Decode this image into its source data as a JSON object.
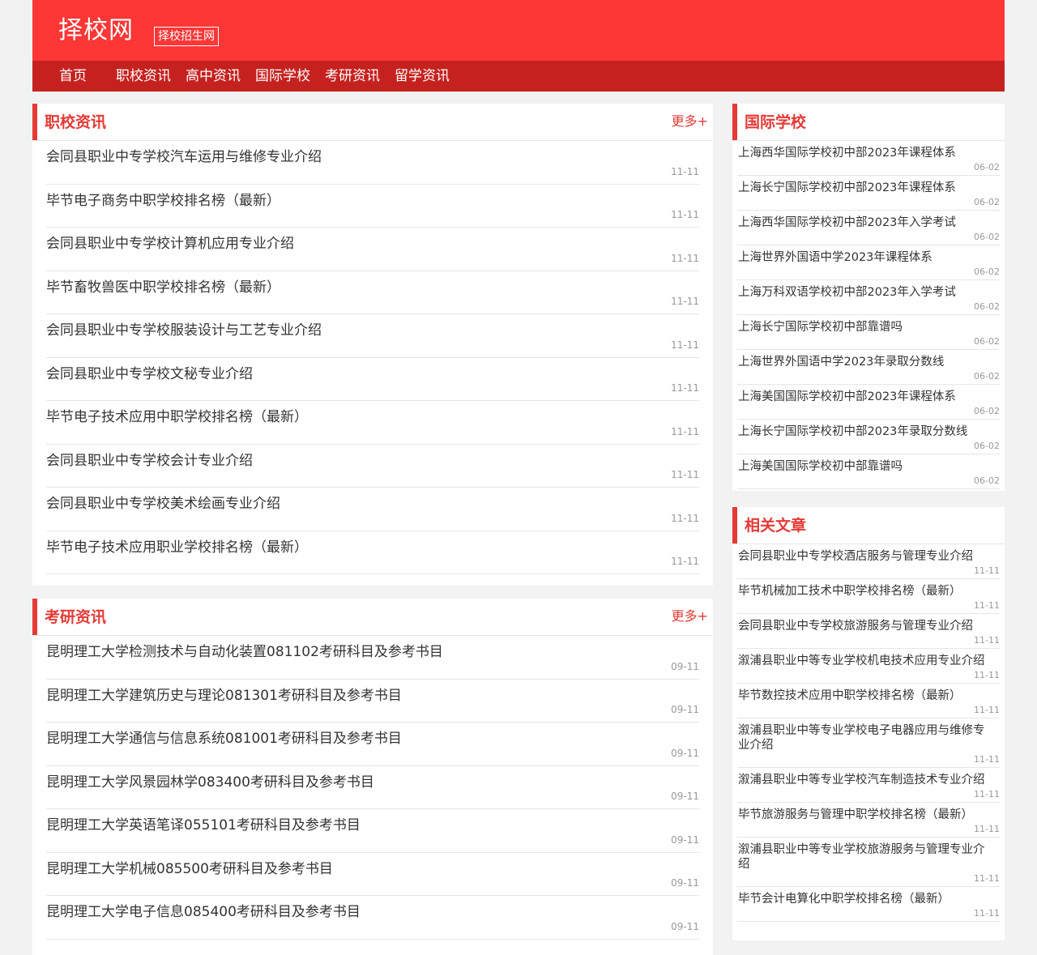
{
  "header": {
    "logo": "择校网",
    "tagline": "择校招生网"
  },
  "nav": {
    "items": [
      "首页",
      "职校资讯",
      "高中资讯",
      "国际学校",
      "考研资讯",
      "留学资讯"
    ]
  },
  "left_panels": [
    {
      "title": "职校资讯",
      "more": "更多+",
      "items": [
        {
          "title": "会同县职业中专学校汽车运用与维修专业介绍",
          "date": "11-11"
        },
        {
          "title": "毕节电子商务中职学校排名榜（最新）",
          "date": "11-11"
        },
        {
          "title": "会同县职业中专学校计算机应用专业介绍",
          "date": "11-11"
        },
        {
          "title": "毕节畜牧兽医中职学校排名榜（最新）",
          "date": "11-11"
        },
        {
          "title": "会同县职业中专学校服装设计与工艺专业介绍",
          "date": "11-11"
        },
        {
          "title": "会同县职业中专学校文秘专业介绍",
          "date": "11-11"
        },
        {
          "title": "毕节电子技术应用中职学校排名榜（最新）",
          "date": "11-11"
        },
        {
          "title": "会同县职业中专学校会计专业介绍",
          "date": "11-11"
        },
        {
          "title": "会同县职业中专学校美术绘画专业介绍",
          "date": "11-11"
        },
        {
          "title": "毕节电子技术应用职业学校排名榜（最新）",
          "date": "11-11"
        }
      ]
    },
    {
      "title": "考研资讯",
      "more": "更多+",
      "items": [
        {
          "title": "昆明理工大学检测技术与自动化装置081102考研科目及参考书目",
          "date": "09-11"
        },
        {
          "title": "昆明理工大学建筑历史与理论081301考研科目及参考书目",
          "date": "09-11"
        },
        {
          "title": "昆明理工大学通信与信息系统081001考研科目及参考书目",
          "date": "09-11"
        },
        {
          "title": "昆明理工大学风景园林学083400考研科目及参考书目",
          "date": "09-11"
        },
        {
          "title": "昆明理工大学英语笔译055101考研科目及参考书目",
          "date": "09-11"
        },
        {
          "title": "昆明理工大学机械085500考研科目及参考书目",
          "date": "09-11"
        },
        {
          "title": "昆明理工大学电子信息085400考研科目及参考书目",
          "date": "09-11"
        }
      ]
    }
  ],
  "right_panels": [
    {
      "title": "国际学校",
      "items": [
        {
          "title": "上海西华国际学校初中部2023年课程体系",
          "date": "06-02"
        },
        {
          "title": "上海长宁国际学校初中部2023年课程体系",
          "date": "06-02"
        },
        {
          "title": "上海西华国际学校初中部2023年入学考试",
          "date": "06-02"
        },
        {
          "title": "上海世界外国语中学2023年课程体系",
          "date": "06-02"
        },
        {
          "title": "上海万科双语学校初中部2023年入学考试",
          "date": "06-02"
        },
        {
          "title": "上海长宁国际学校初中部靠谱吗",
          "date": "06-02"
        },
        {
          "title": "上海世界外国语中学2023年录取分数线",
          "date": "06-02"
        },
        {
          "title": "上海美国国际学校初中部2023年课程体系",
          "date": "06-02"
        },
        {
          "title": "上海长宁国际学校初中部2023年录取分数线",
          "date": "06-02"
        },
        {
          "title": "上海美国国际学校初中部靠谱吗",
          "date": "06-02"
        }
      ]
    },
    {
      "title": "相关文章",
      "items": [
        {
          "title": "会同县职业中专学校酒店服务与管理专业介绍",
          "date": "11-11"
        },
        {
          "title": "毕节机械加工技术中职学校排名榜（最新）",
          "date": "11-11"
        },
        {
          "title": "会同县职业中专学校旅游服务与管理专业介绍",
          "date": "11-11"
        },
        {
          "title": "溆浦县职业中等专业学校机电技术应用专业介绍",
          "date": "11-11"
        },
        {
          "title": "毕节数控技术应用中职学校排名榜（最新）",
          "date": "11-11"
        },
        {
          "title": "溆浦县职业中等专业学校电子电器应用与维修专业介绍",
          "date": "11-11"
        },
        {
          "title": "溆浦县职业中等专业学校汽车制造技术专业介绍",
          "date": "11-11"
        },
        {
          "title": "毕节旅游服务与管理中职学校排名榜（最新）",
          "date": "11-11"
        },
        {
          "title": "溆浦县职业中等专业学校旅游服务与管理专业介绍",
          "date": "11-11"
        },
        {
          "title": "毕节会计电算化中职学校排名榜（最新）",
          "date": "11-11"
        }
      ]
    }
  ]
}
